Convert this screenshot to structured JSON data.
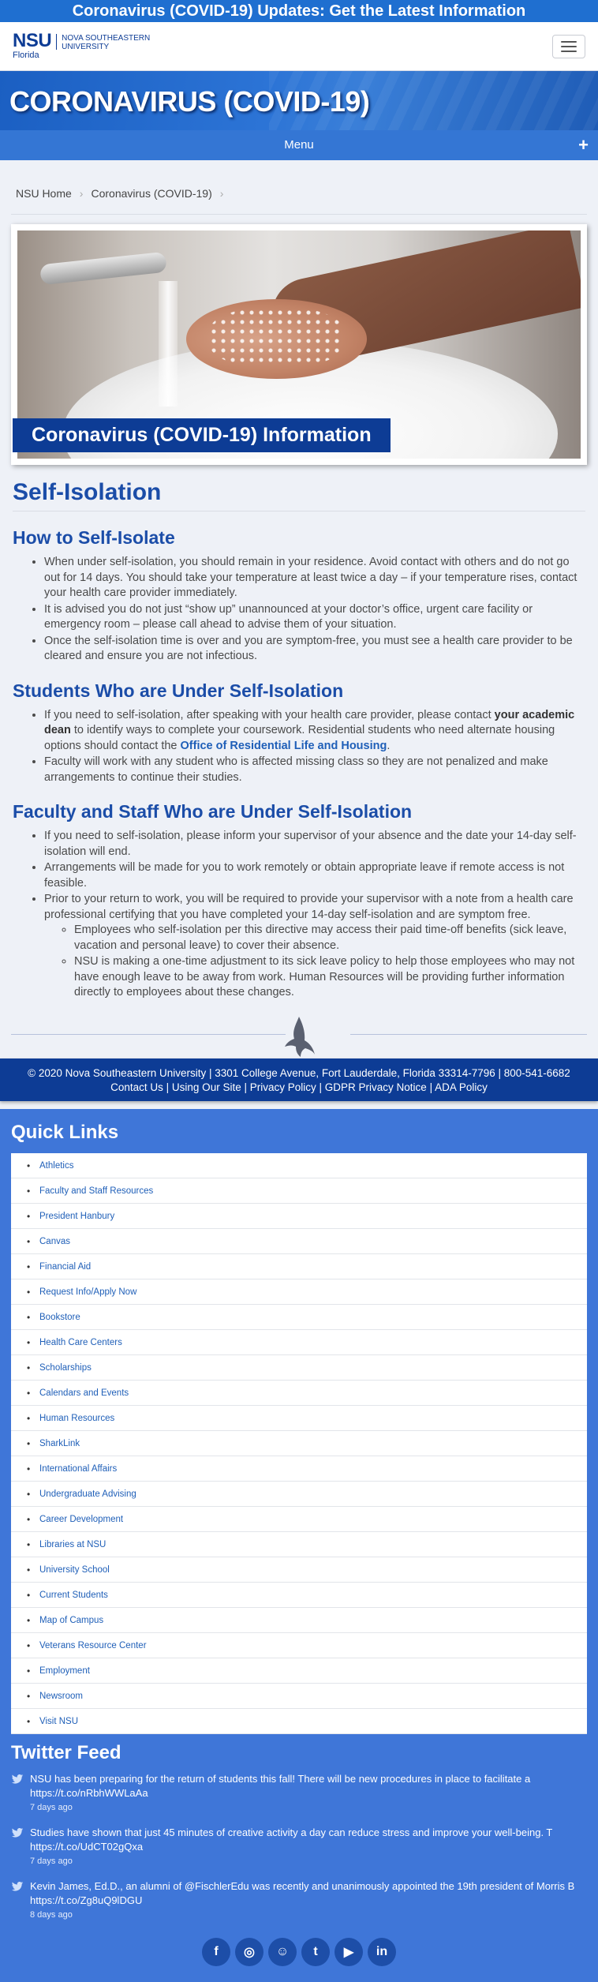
{
  "alert": {
    "text": "Coronavirus (COVID-19) Updates: Get the Latest Information"
  },
  "header": {
    "logo_nsu": "NSU",
    "logo_florida": "Florida",
    "logo_name_line1": "Nova Southeastern",
    "logo_name_line2": "University"
  },
  "banner": {
    "title": "CORONAVIRUS (COVID-19)"
  },
  "menu": {
    "label": "Menu",
    "toggle": "+"
  },
  "breadcrumb": {
    "items": [
      "NSU Home",
      "Coronavirus (COVID-19)"
    ]
  },
  "hero": {
    "caption": "Coronavirus (COVID-19) Information"
  },
  "page": {
    "title": "Self-Isolation"
  },
  "how": {
    "title": "How to Self-Isolate",
    "items": [
      "When under self-isolation, you should remain in your residence. Avoid contact with others and do not go out for 14 days. You should take your temperature at least twice a day – if your temperature rises, contact your health care provider immediately.",
      "It is advised you do not just “show up” unannounced at your doctor’s office, urgent care facility or emergency room – please call ahead to advise them of your situation.",
      "Once the self-isolation time is over and you are symptom-free, you must see a health care provider to be cleared and ensure you are not infectious."
    ]
  },
  "students": {
    "title": "Students Who are Under Self-Isolation",
    "item1_pre": "If you need to self-isolation, after speaking with your health care provider, please contact ",
    "item1_bold": "your academic dean",
    "item1_mid": " to identify ways to complete your coursework. Residential students who need alternate housing options should contact the ",
    "item1_link": "Office of Residential Life and Housing",
    "item1_end": ".",
    "item2": "Faculty will work with any student who is affected missing class so they are not penalized and make arrangements to continue their studies."
  },
  "faculty": {
    "title": "Faculty and Staff Who are Under Self-Isolation",
    "items": [
      "If you need to self-isolation, please inform your supervisor of your absence and the date your 14-day self-isolation will end.",
      "Arrangements will be made for you to work remotely or obtain appropriate leave if remote access is not feasible.",
      "Prior to your return to work, you will be required to provide your supervisor with a note from a health care professional certifying that you have completed your 14-day self-isolation and are symptom free."
    ],
    "subitems": [
      "Employees who self-isolation per this directive may access their paid time-off benefits (sick leave, vacation and personal leave) to cover their absence.",
      "NSU is making a one-time adjustment to its sick leave policy to help those employees who may not have enough leave to be away from work. Human Resources will be providing further information directly to employees about these changes."
    ]
  },
  "footer": {
    "line1": "© 2020 Nova Southeastern University | 3301 College Avenue, Fort Lauderdale, Florida 33314-7796 | 800-541-6682",
    "links": [
      "Contact Us",
      "Using Our Site",
      "Privacy Policy",
      "GDPR Privacy Notice",
      "ADA Policy"
    ],
    "sep": " | "
  },
  "quick_links": {
    "title": "Quick Links",
    "items": [
      "Athletics",
      "Faculty and Staff Resources",
      "President Hanbury",
      "Canvas",
      "Financial Aid",
      "Request Info/Apply Now",
      "Bookstore",
      "Health Care Centers",
      "Scholarships",
      "Calendars and Events",
      "Human Resources",
      "SharkLink",
      "International Affairs",
      "Undergraduate Advising",
      "Career Development",
      "Libraries at NSU",
      "University School",
      "Current Students",
      "Map of Campus",
      "Veterans Resource Center",
      "Employment",
      "Newsroom",
      "Visit NSU"
    ]
  },
  "twitter": {
    "title": "Twitter Feed",
    "tweets": [
      {
        "text": "NSU has been preparing for the return of students this fall! There will be new procedures in place to facilitate a",
        "link": "https://t.co/nRbhWWLaAa",
        "time": "7 days ago"
      },
      {
        "text": "Studies have shown that just 45 minutes of creative activity a day can reduce stress and improve your well-being. T",
        "link": "https://t.co/UdCT02gQxa",
        "time": "7 days ago"
      },
      {
        "text": "Kevin James, Ed.D., an alumni of @FischlerEdu was recently and unanimously appointed the 19th president of Morris B",
        "link": "https://t.co/Zg8uQ9lDGU",
        "time": "8 days ago"
      }
    ]
  },
  "social": {
    "icons": [
      "facebook-icon",
      "instagram-icon",
      "snapchat-icon",
      "twitter-icon",
      "youtube-icon",
      "linkedin-icon"
    ],
    "glyphs": [
      "f",
      "◎",
      "☺",
      "t",
      "▶",
      "in"
    ]
  },
  "colors": {
    "primary_dark": "#0d3c95",
    "primary": "#1f6fd0",
    "quick_links_bg": "#3f76d8",
    "heading": "#1b4da8"
  }
}
